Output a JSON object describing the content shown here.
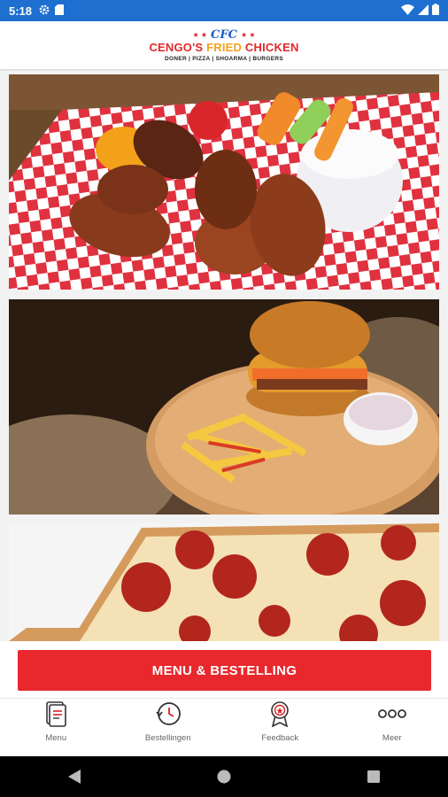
{
  "status_bar": {
    "time": "5:18",
    "icons_left": [
      "gear-icon",
      "sd-card-icon"
    ],
    "icons_right": [
      "wifi-icon",
      "signal-icon",
      "battery-icon"
    ]
  },
  "header": {
    "logo_badge": "CFC",
    "logo_title_part1": "CENGO'S ",
    "logo_title_part2": "FRIED",
    "logo_title_part3": " CHICKEN",
    "logo_subtitle": "DONER | PIZZA | SHOARMA | BURGERS"
  },
  "tiles": [
    {
      "name": "chicken-wings-image"
    },
    {
      "name": "burger-fries-image"
    },
    {
      "name": "pepperoni-pizza-image"
    }
  ],
  "cta": {
    "label": "MENU & BESTELLING"
  },
  "bottom_nav": {
    "items": [
      {
        "label": "Menu",
        "icon": "menu-card-icon"
      },
      {
        "label": "Bestellingen",
        "icon": "history-icon"
      },
      {
        "label": "Feedback",
        "icon": "award-icon"
      },
      {
        "label": "Meer",
        "icon": "more-icon"
      }
    ]
  },
  "colors": {
    "status_bar": "#1e6fd0",
    "accent_red": "#e8282c",
    "logo_blue": "#1d5bc7",
    "logo_orange": "#f6a21b"
  }
}
